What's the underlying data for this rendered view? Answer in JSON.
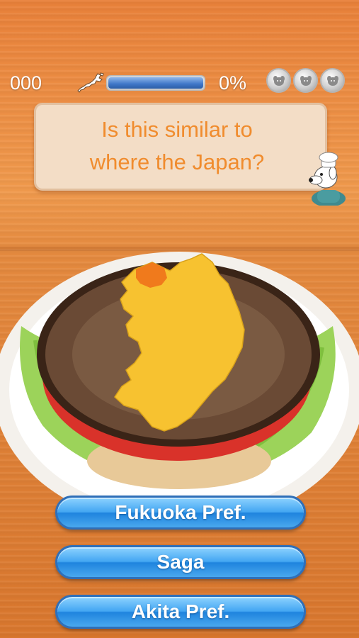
{
  "hud": {
    "score": "000",
    "progress_percent_label": "0%",
    "progress_value": 0,
    "coins": [
      "dog-coin-icon",
      "dog-coin-icon",
      "dog-coin-icon"
    ]
  },
  "question": {
    "line1": "Is this similar to",
    "line2": "where the Japan?"
  },
  "answers": [
    {
      "label": "Fukuoka Pref."
    },
    {
      "label": "Saga"
    },
    {
      "label": "Akita Pref."
    }
  ],
  "colors": {
    "background": "#e9813a",
    "question_text": "#f08c2e",
    "question_bg": "#f3ddc6",
    "button_blue": "#43a6f2",
    "map_yellow": "#f7c230",
    "map_highlight": "#f07a1c"
  }
}
